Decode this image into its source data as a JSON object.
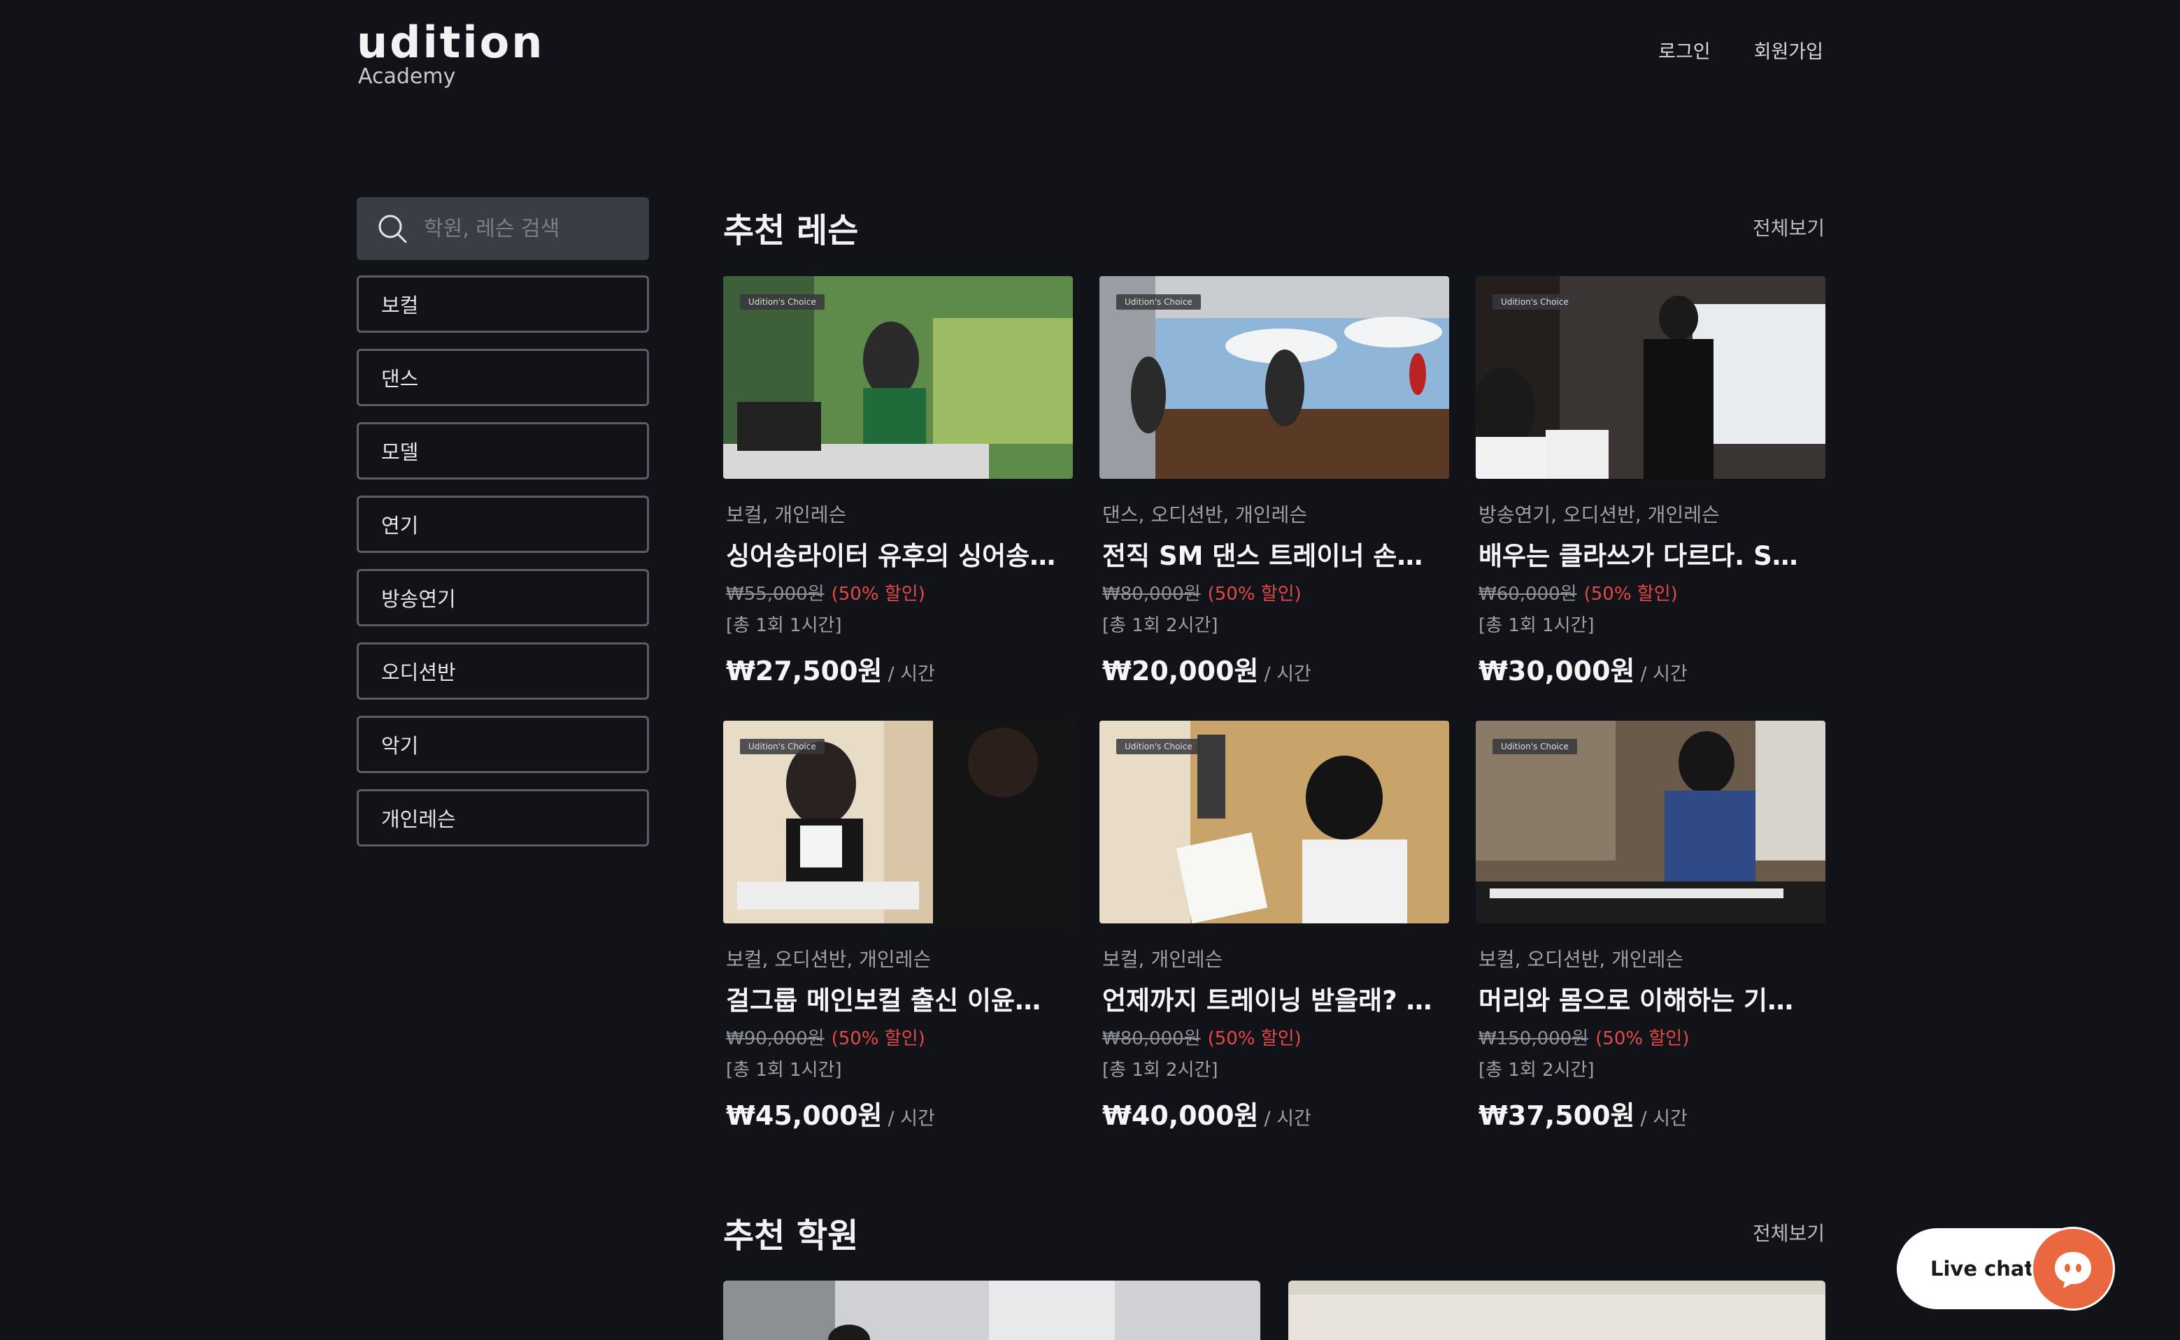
{
  "brand": {
    "name": "udition",
    "sub": "Academy"
  },
  "nav": {
    "login": "로그인",
    "signup": "회원가입"
  },
  "search": {
    "placeholder": "학원, 레슨 검색"
  },
  "categories": [
    "보컬",
    "댄스",
    "모델",
    "연기",
    "방송연기",
    "오디션반",
    "악기",
    "개인레슨"
  ],
  "recommended_lessons": {
    "title": "추천 레슨",
    "see_all": "전체보기",
    "badge": "Udition's Choice",
    "unit": "/ 시간",
    "cards": [
      {
        "tags": "보컬, 개인레슨",
        "title": "싱어송라이터 유후의 싱어송라이팅 클래스",
        "original_price": "₩55,000원",
        "discount": "(50% 할인)",
        "duration": "[총 1회 1시간]",
        "price": "₩27,500원"
      },
      {
        "tags": "댄스, 오디션반, 개인레슨",
        "title": "전직 SM 댄스 트레이너 손혜진의 댄스 클래스",
        "original_price": "₩80,000원",
        "discount": "(50% 할인)",
        "duration": "[총 1회 2시간]",
        "price": "₩20,000원"
      },
      {
        "tags": "방송연기, 오디션반, 개인레슨",
        "title": "배우는 클라쓰가 다르다. SBS 공채 출신 배우의 연기 수업",
        "original_price": "₩60,000원",
        "discount": "(50% 할인)",
        "duration": "[총 1회 1시간]",
        "price": "₩30,000원"
      },
      {
        "tags": "보컬, 오디션반, 개인레슨",
        "title": "걸그룹 메인보컬 출신 이윤지의 보컬 레슨",
        "original_price": "₩90,000원",
        "discount": "(50% 할인)",
        "duration": "[총 1회 1시간]",
        "price": "₩45,000원"
      },
      {
        "tags": "보컬, 개인레슨",
        "title": "언제까지 트레이닝 받을래? 보컬 트레이닝 클래스",
        "original_price": "₩80,000원",
        "discount": "(50% 할인)",
        "duration": "[총 1회 2시간]",
        "price": "₩40,000원"
      },
      {
        "tags": "보컬, 오디션반, 개인레슨",
        "title": "머리와 몸으로 이해하는 기본기 보컬 클래스",
        "original_price": "₩150,000원",
        "discount": "(50% 할인)",
        "duration": "[총 1회 2시간]",
        "price": "₩37,500원"
      }
    ]
  },
  "recommended_academies": {
    "title": "추천 학원",
    "see_all": "전체보기"
  },
  "live_chat": {
    "label": "Live chat"
  },
  "colors": {
    "background": "#111318",
    "discount": "#e34949",
    "chat_accent": "#e9683f"
  }
}
